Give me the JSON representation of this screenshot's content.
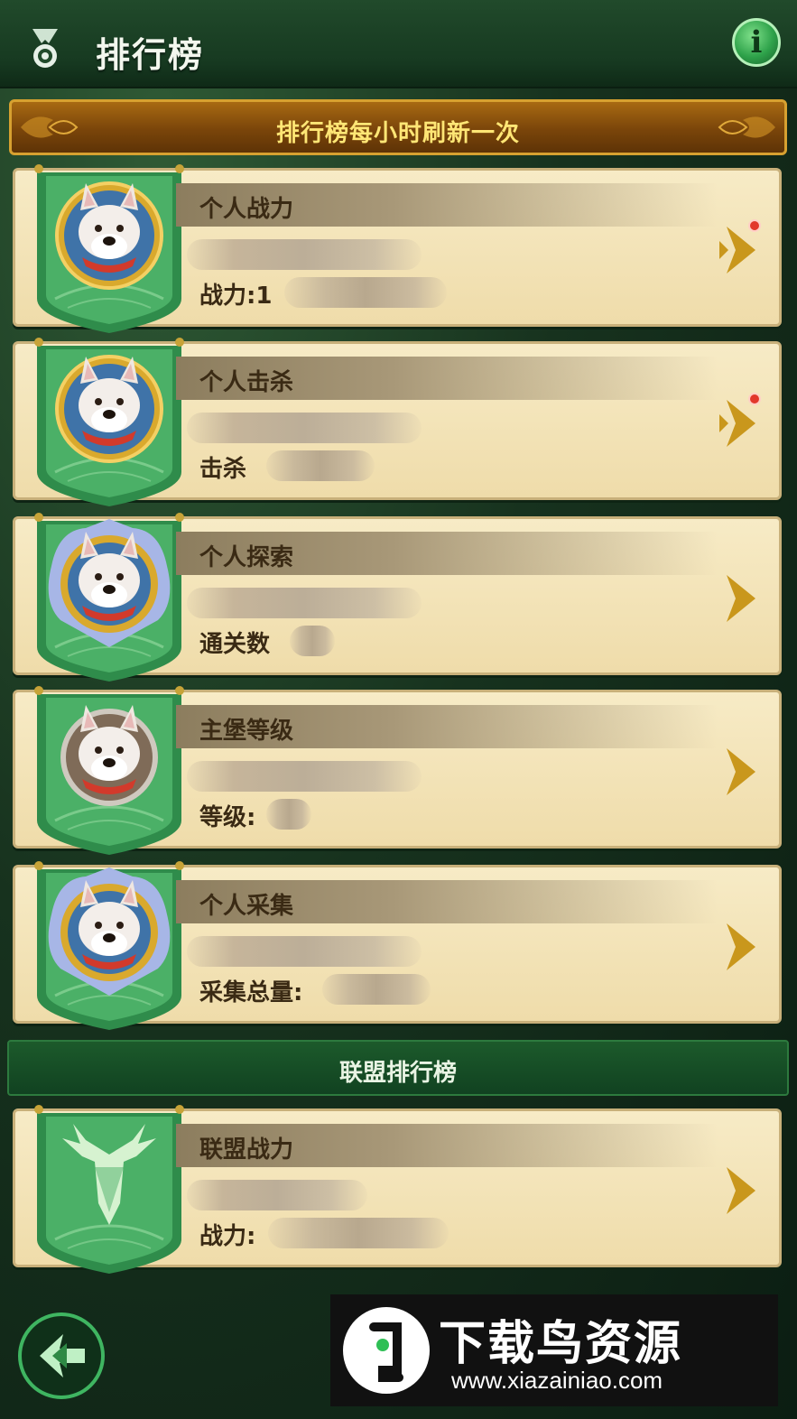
{
  "header": {
    "title": "排行榜",
    "medal_icon": "medal-icon",
    "info_label": "i",
    "info_icon": "info-icon"
  },
  "banner": {
    "text": "排行榜每小时刷新一次"
  },
  "cards": [
    {
      "title": "个人战力",
      "stat_label": "战力:1",
      "has_dot": true,
      "avatar": "dog-avatar-gold-frame"
    },
    {
      "title": "个人击杀",
      "stat_label": "击杀",
      "has_dot": true,
      "avatar": "dog-avatar-gold-frame"
    },
    {
      "title": "个人探索",
      "stat_label": "通关数",
      "has_dot": false,
      "avatar": "dog-avatar-crystal-frame"
    },
    {
      "title": "主堡等级",
      "stat_label": "等级:",
      "has_dot": false,
      "avatar": "dog-avatar-plain-frame"
    },
    {
      "title": "个人采集",
      "stat_label": "采集总量:",
      "has_dot": false,
      "avatar": "dog-avatar-crystal-frame"
    }
  ],
  "alliance_section": {
    "label": "联盟排行榜",
    "cards": [
      {
        "title": "联盟战力",
        "stat_label": "战力:",
        "has_dot": false,
        "avatar": "stag-emblem"
      }
    ]
  },
  "footer": {
    "back_icon": "back-arrow-icon"
  },
  "watermark": {
    "title": "下载鸟资源",
    "url": "www.xiazainiao.com",
    "logo": "bird-logo-icon"
  },
  "colors": {
    "background": "#17321e",
    "banner_text": "#ffe675",
    "card_bg": "#f2e2b4",
    "card_title": "#3a2a14",
    "arrow": "#c9971c",
    "flag_green": "#3aa35a",
    "notify_dot": "#e2382b"
  }
}
